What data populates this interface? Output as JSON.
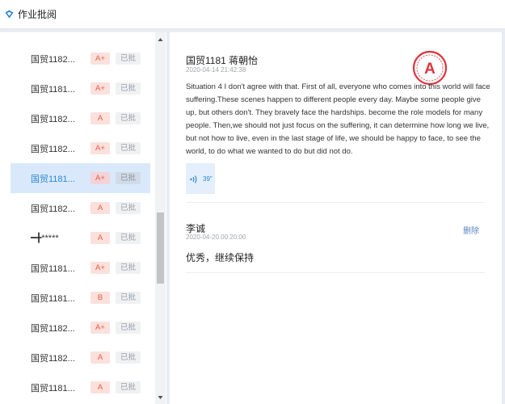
{
  "app": {
    "title": "作业批阅",
    "icon": "app-logo-icon"
  },
  "list": {
    "items": [
      {
        "name": "国贸1182...",
        "grade": "A+",
        "status": "已批"
      },
      {
        "name": "国贸1181...",
        "grade": "A+",
        "status": "已批"
      },
      {
        "name": "国贸1182...",
        "grade": "A",
        "status": "已批"
      },
      {
        "name": "国贸1182...",
        "grade": "A+",
        "status": "已批"
      },
      {
        "name": "国贸1181...",
        "grade": "A+",
        "status": "已批",
        "selected": true
      },
      {
        "name": "国贸1182...",
        "grade": "A",
        "status": "已批"
      },
      {
        "name": "━╋*****",
        "grade": "A",
        "status": "已批"
      },
      {
        "name": "国贸1181...",
        "grade": "A+",
        "status": "已批"
      },
      {
        "name": "国贸1181...",
        "grade": "B",
        "status": "已批"
      },
      {
        "name": "国贸1182...",
        "grade": "A+",
        "status": "已批"
      },
      {
        "name": "国贸1182...",
        "grade": "A",
        "status": "已批"
      },
      {
        "name": "国贸1181...",
        "grade": "A",
        "status": "已批"
      }
    ]
  },
  "detail": {
    "author": "国贸1181 蒋朝怡",
    "timestamp": "2020-04-14 21:42:38",
    "stamp_grade": "A",
    "essay": "Situation 4 I don't agree with that. First of all, everyone who comes into this world will face suffering.These scenes happen to different people every day. Maybe some people give up, but others don't. They bravely face the hardships. become the role models for many people. Then,we should not just focus on the suffering, it can determine how long we live, but not how to live, even in the last stage of life, we should be happy to face, to see the world, to do what we wanted to do but did not do.",
    "audio": {
      "duration": "39\"",
      "icon": "audio-wave-icon"
    }
  },
  "comment": {
    "teacher": "李诚",
    "time": "2020-04-20 00:20:00",
    "delete_label": "删除",
    "text": "优秀，继续保持"
  },
  "colors": {
    "accent": "#2b88d8",
    "grade_text": "#e85c4a",
    "grade_bg": "#fbe0dc",
    "selected_bg": "#d9e9fb",
    "stamp": "#e0323c"
  }
}
